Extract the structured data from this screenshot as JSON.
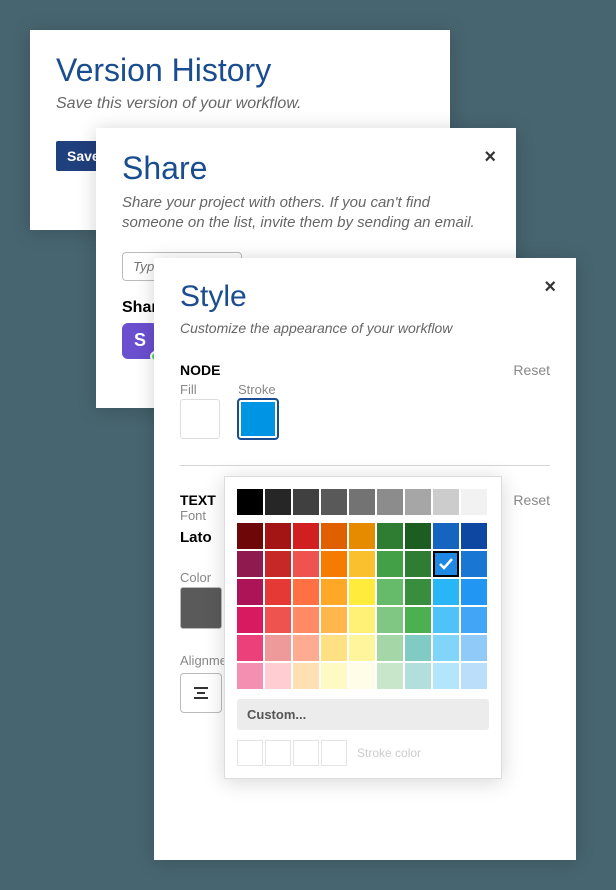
{
  "version": {
    "title": "Version History",
    "subtitle": "Save this version of your workflow.",
    "save_label": "Save"
  },
  "share": {
    "title": "Share",
    "subtitle": "Share your project with others. If you can't find someone on the list, invite them by sending an email.",
    "input_placeholder": "Type",
    "shared_label": "Share",
    "avatar_initial": "S"
  },
  "style": {
    "title": "Style",
    "subtitle": "Customize the appearance of your workflow",
    "node_section": "NODE",
    "text_section": "TEXT",
    "reset_label": "Reset",
    "fill_label": "Fill",
    "stroke_label": "Stroke",
    "font_label": "Font",
    "font_value": "Lato",
    "color_label": "Color",
    "alignment_label": "Alignme",
    "fill_value": "#FFFFFF",
    "stroke_value": "#0095E4",
    "text_color_value": "#5A5A5A"
  },
  "picker": {
    "custom_label": "Custom...",
    "stroke_color_label": "Stroke color",
    "grays": [
      "#000000",
      "#262626",
      "#404040",
      "#595959",
      "#737373",
      "#8c8c8c",
      "#a6a6a6",
      "#cccccc",
      "#f2f2f2"
    ],
    "grid": [
      [
        "#6e0808",
        "#a31515",
        "#d11f1f",
        "#e06000",
        "#e68a00",
        "#2e7d32",
        "#1b5e20",
        "#1565c0",
        "#0d47a1"
      ],
      [
        "#8e1a4f",
        "#c62828",
        "#ef5350",
        "#f57c00",
        "#fbc02d",
        "#43a047",
        "#2e7d32",
        "#1e88e5",
        "#1976d2"
      ],
      [
        "#ad1457",
        "#e53935",
        "#ff7043",
        "#ffa726",
        "#ffeb3b",
        "#66bb6a",
        "#388e3c",
        "#29b6f6",
        "#2196f3"
      ],
      [
        "#d81b60",
        "#ef5350",
        "#ff8a65",
        "#ffb74d",
        "#fff176",
        "#81c784",
        "#4caf50",
        "#4fc3f7",
        "#42a5f5"
      ],
      [
        "#ec407a",
        "#ef9a9a",
        "#ffab91",
        "#ffe082",
        "#fff59d",
        "#a5d6a7",
        "#80cbc4",
        "#81d4fa",
        "#90caf9"
      ],
      [
        "#f48fb1",
        "#ffcdd2",
        "#ffe0b2",
        "#fff9c4",
        "#fffde7",
        "#c8e6c9",
        "#b2dfdb",
        "#b3e5fc",
        "#bbdefb"
      ]
    ],
    "selected_row": 1,
    "selected_col": 7
  }
}
